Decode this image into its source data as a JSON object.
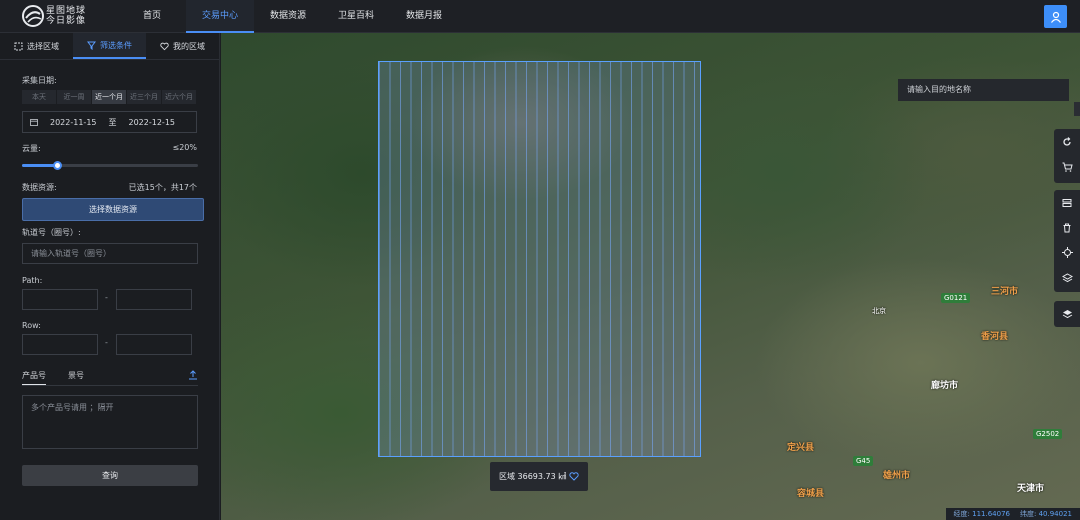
{
  "app": {
    "logo_line1": "星图地球",
    "logo_line2": "今日影像"
  },
  "nav": [
    {
      "label": "首页",
      "active": false
    },
    {
      "label": "交易中心",
      "active": true
    },
    {
      "label": "数据资源",
      "active": false
    },
    {
      "label": "卫星百科",
      "active": false
    },
    {
      "label": "数据月报",
      "active": false
    }
  ],
  "sidebar": {
    "tabs": [
      {
        "label": "选择区域",
        "icon": "select-area-icon"
      },
      {
        "label": "筛选条件",
        "icon": "filter-icon"
      },
      {
        "label": "我的区域",
        "icon": "heart-icon"
      }
    ],
    "collect_date_label": "采集日期:",
    "quick_ranges": [
      "本天",
      "近一周",
      "近一个月",
      "近三个月",
      "近六个月"
    ],
    "active_range": "近一个月",
    "date_start": "2022-11-15",
    "date_to": "至",
    "date_end": "2022-12-15",
    "cloud_label": "云量:",
    "cloud_value": "≤20%",
    "cloud_fraction": 0.2,
    "source_label": "数据资源:",
    "source_summary": "已选15个，共17个",
    "select_source_button": "选择数据资源",
    "orbit_label": "轨道号（圈号）:",
    "orbit_placeholder": "请输入轨道号（圈号）",
    "path_label": "Path:",
    "row_label": "Row:",
    "range_sep": "-",
    "product_tabs": [
      "产品号",
      "景号"
    ],
    "product_placeholder": "多个产品号请用 ；隔开",
    "query_button": "查询"
  },
  "map": {
    "search_placeholder": "请输入目的地名称",
    "area_label": "区域 36693.73 ㎢",
    "tools_top": [
      "refresh-icon",
      "cart-icon"
    ],
    "tools_mid": [
      "layer-stack-icon",
      "trash-icon",
      "locate-icon",
      "layers-icon"
    ],
    "tools_bottom": [
      "layers-alt-icon"
    ],
    "roads": [
      "G0121",
      "G2502",
      "G45"
    ],
    "cities": [
      "三河市",
      "香河县",
      "廊坊市",
      "定兴县",
      "雄州市",
      "容城县",
      "天津市",
      "北京"
    ],
    "status_lng_label": "经度:",
    "status_lng": "111.64076",
    "status_lat_label": "纬度:",
    "status_lat": "40.94021"
  }
}
